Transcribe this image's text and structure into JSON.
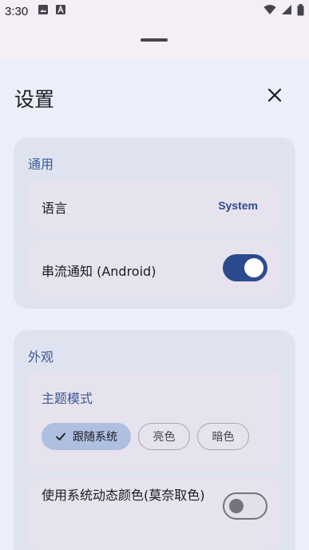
{
  "status_bar": {
    "time": "3:30",
    "left_icons": [
      "image-icon",
      "a-box-icon"
    ],
    "right_icons": [
      "wifi-icon",
      "signal-icon",
      "battery-icon"
    ]
  },
  "header": {
    "title": "设置",
    "close_icon": "close-icon"
  },
  "general": {
    "title": "通用",
    "language_label": "语言",
    "language_value": "System",
    "stream_notification_label": "串流通知 (Android)",
    "stream_notification_enabled": true
  },
  "appearance": {
    "title": "外观",
    "theme_mode_title": "主题模式",
    "theme_options": [
      {
        "label": "跟随系统",
        "selected": true
      },
      {
        "label": "亮色",
        "selected": false
      },
      {
        "label": "暗色",
        "selected": false
      }
    ],
    "dynamic_color_label": "使用系统动态颜色(莫奈取色)",
    "dynamic_color_enabled": false
  },
  "colors": {
    "accent": "#2b4b8e",
    "section_title": "#3a5a97",
    "sheet_bg": "#eaeff9",
    "card_bg": "#dfe3ef",
    "row_bg": "#e6e2ee"
  }
}
